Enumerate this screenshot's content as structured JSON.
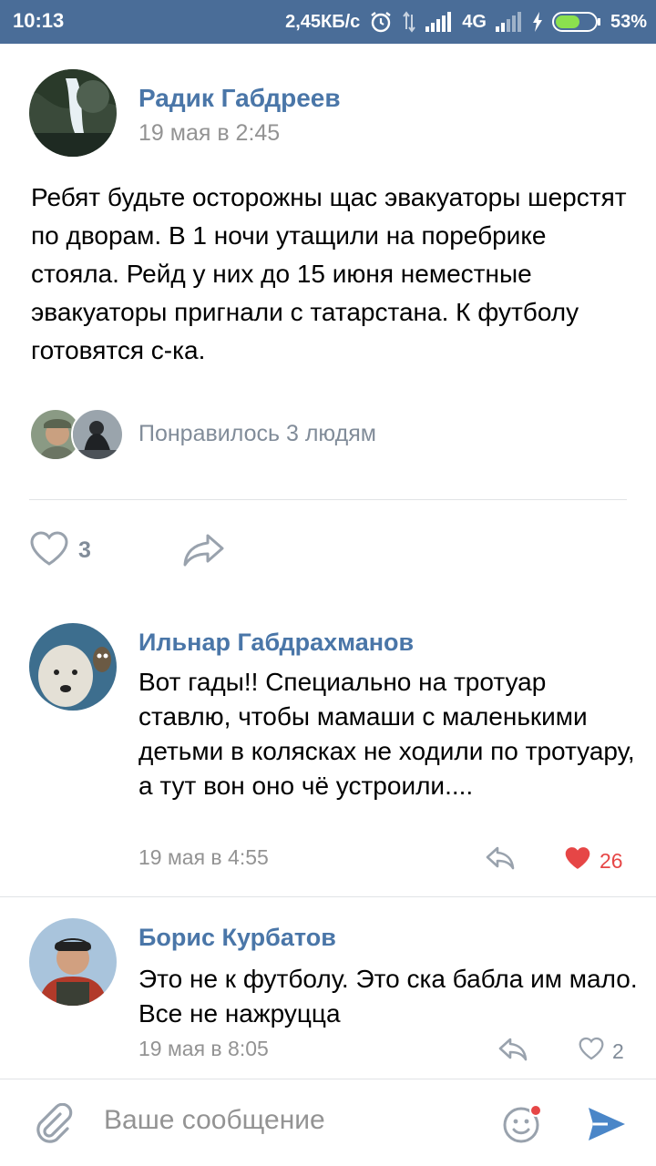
{
  "status_bar": {
    "time": "10:13",
    "speed": "2,45КБ/с",
    "network": "4G",
    "battery": "53%"
  },
  "post": {
    "author": "Радик Габдреев",
    "date": "19 мая в 2:45",
    "text": "Ребят будьте осторожны щас эвакуаторы шерстят по дворам. В 1 ночи утащили на поребрике стояла. Рейд у них до 15 июня неместные эвакуаторы пригнали с татарстана. К футболу готовятся с-ка.",
    "likes_text": "Понравилось 3 людям",
    "like_count": "3"
  },
  "comments": [
    {
      "author": "Ильнар Габдрахманов",
      "text": "Вот гады!! Специально на тротуар ставлю, чтобы мамаши с маленькими детьми в колясках не ходили по тротуару, а тут вон оно чё устроили....",
      "date": "19 мая в 4:55",
      "likes": "26",
      "liked": true
    },
    {
      "author": "Борис Курбатов",
      "text": "Это не к футболу. Это ска бабла им мало. Все не нажруцца",
      "date": "19 мая в 8:05",
      "likes": "2",
      "liked": false
    }
  ],
  "composer": {
    "placeholder": "Ваше сообщение"
  },
  "colors": {
    "status_bar": "#4a6d98",
    "link": "#4a76a8",
    "muted": "#939393",
    "liked": "#e64646",
    "icon": "#99a2ad",
    "send": "#4a86c8"
  },
  "icons": [
    "alarm-icon",
    "signal-icon",
    "battery-icon",
    "heart-icon",
    "share-icon",
    "reply-icon",
    "attach-icon",
    "smile-icon",
    "send-icon"
  ]
}
